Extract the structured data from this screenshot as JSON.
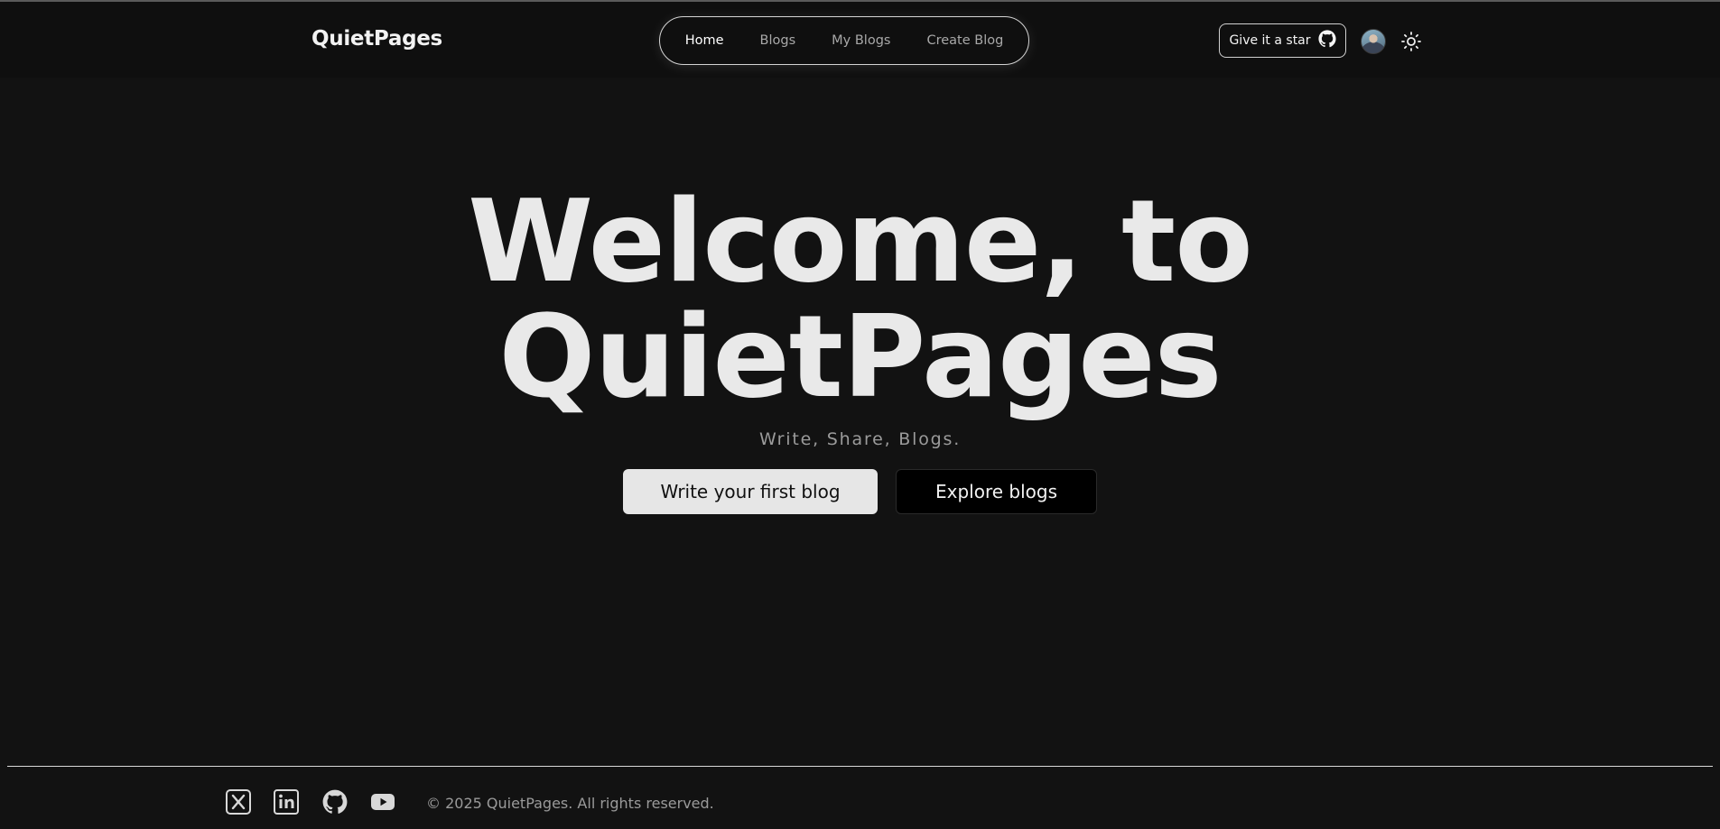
{
  "header": {
    "brand": "QuietPages",
    "nav": [
      {
        "label": "Home",
        "active": true
      },
      {
        "label": "Blogs",
        "active": false
      },
      {
        "label": "My Blogs",
        "active": false
      },
      {
        "label": "Create Blog",
        "active": false
      }
    ],
    "star_button_label": "Give it a star",
    "star_button_icon": "github-icon",
    "avatar_icon": "user-avatar",
    "theme_toggle_icon": "sun-icon"
  },
  "hero": {
    "title_line1": "Welcome, to",
    "title_line2": "QuietPages",
    "subtitle": "Write, Share, Blogs.",
    "primary_cta": "Write your first blog",
    "secondary_cta": "Explore blogs"
  },
  "footer": {
    "social_icons": [
      "x-twitter-icon",
      "linkedin-icon",
      "github-icon",
      "youtube-icon"
    ],
    "copyright": "© 2025 QuietPages. All rights reserved."
  },
  "colors": {
    "background": "#121212",
    "navbar": "#0f0f0f",
    "text": "#e9e9e9",
    "muted": "#9b9b9b",
    "primary_button": "#e6e6e6",
    "secondary_button": "#000000"
  }
}
